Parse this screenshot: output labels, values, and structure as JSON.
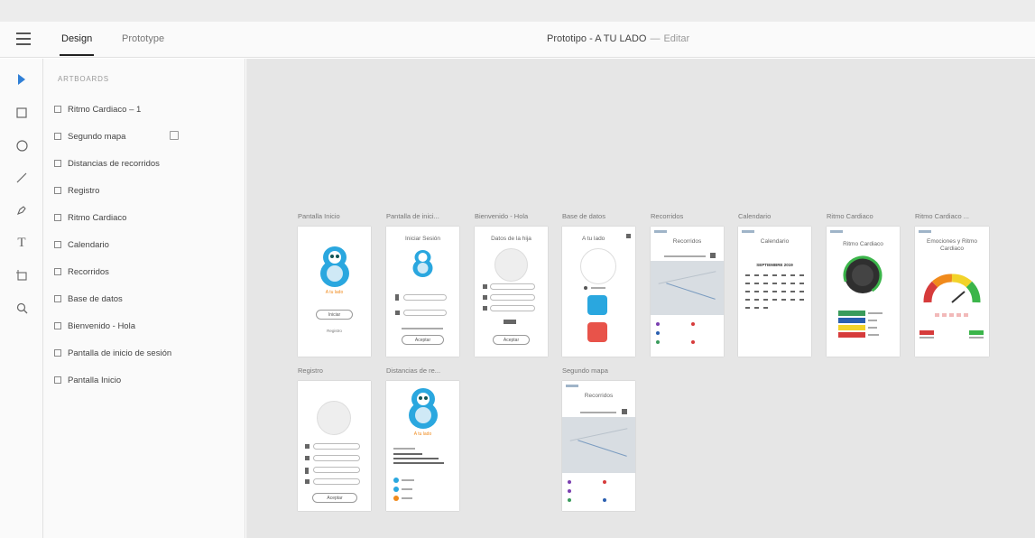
{
  "header": {
    "tabs": [
      {
        "label": "Design",
        "active": true
      },
      {
        "label": "Prototype",
        "active": false
      }
    ],
    "document_title": "Prototipo - A TU LADO",
    "separator": "—",
    "status": "Editar"
  },
  "tools": [
    "select-arrow-icon",
    "rectangle-icon",
    "ellipse-icon",
    "line-icon",
    "pen-icon",
    "text-icon",
    "artboard-icon",
    "zoom-icon"
  ],
  "layers": {
    "heading": "ARTBOARDS",
    "items": [
      {
        "label": "Ritmo Cardiaco – 1"
      },
      {
        "label": "Segundo mapa"
      },
      {
        "label": "Distancias de recorridos"
      },
      {
        "label": "Registro"
      },
      {
        "label": "Ritmo Cardiaco"
      },
      {
        "label": "Calendario"
      },
      {
        "label": "Recorridos"
      },
      {
        "label": "Base de datos"
      },
      {
        "label": "Bienvenido - Hola"
      },
      {
        "label": "Pantalla de inicio de sesión"
      },
      {
        "label": "Pantalla Inicio"
      }
    ]
  },
  "artboards": [
    {
      "label": "Pantalla Inicio",
      "screen_text": "A tu lado",
      "button": "Iniciar",
      "link": "Registro"
    },
    {
      "label": "Pantalla de inici...",
      "screen_title": "Iniciar Sesión",
      "button": "Aceptar"
    },
    {
      "label": "Bienvenido - Hola",
      "screen_title": "Datos de la hija",
      "button": "Aceptar"
    },
    {
      "label": "Base de datos",
      "screen_title": "A tu lado"
    },
    {
      "label": "Recorridos",
      "screen_title": "Recorridos"
    },
    {
      "label": "Calendario",
      "screen_title": "Calendario",
      "month": "SEPTIEMBRE 2019"
    },
    {
      "label": "Ritmo Cardiaco",
      "screen_title": "Ritmo Cardiaco"
    },
    {
      "label": "Ritmo Cardiaco ...",
      "screen_title": "Emociones y Ritmo Cardiaco"
    },
    {
      "label": "Registro",
      "button": "Aceptar"
    },
    {
      "label": "Distancias de re...",
      "screen_text": "A tu lado"
    },
    {
      "label": "Segundo mapa",
      "screen_title": "Recorridos"
    }
  ],
  "colors": {
    "accent_blue": "#2aa7df",
    "brand_orange": "#f08a1c",
    "canvas_bg": "#e6e6e6",
    "panel_bg": "#fafafa"
  }
}
